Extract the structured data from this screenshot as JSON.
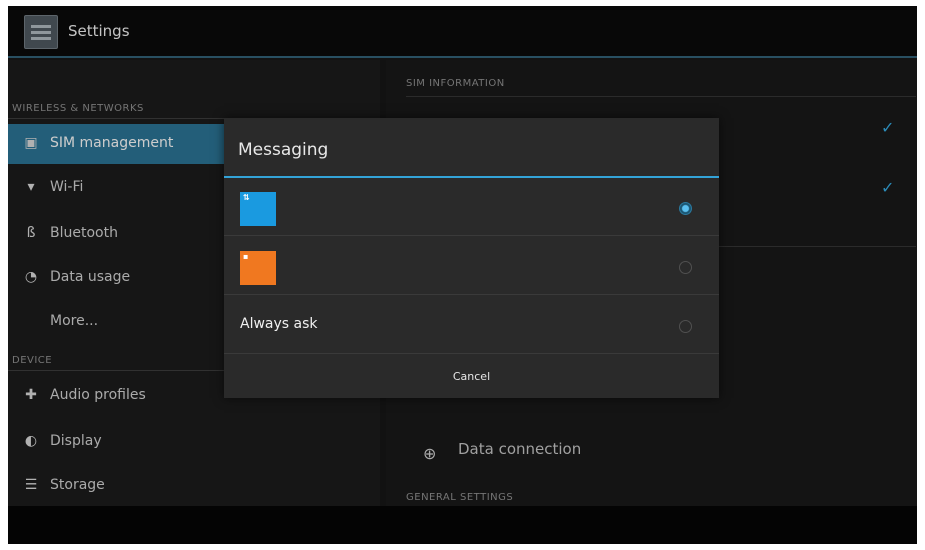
{
  "action_bar": {
    "title": "Settings",
    "icon": "settings-icon"
  },
  "left_pane": {
    "sections": [
      {
        "header": "WIRELESS & NETWORKS",
        "items": [
          {
            "label": "SIM management",
            "icon": "sim-icon",
            "selected": true
          },
          {
            "label": "Wi-Fi",
            "icon": "wifi-icon"
          },
          {
            "label": "Bluetooth",
            "icon": "bluetooth-icon"
          },
          {
            "label": "Data usage",
            "icon": "data-usage-icon"
          },
          {
            "label": "More...",
            "icon": ""
          }
        ]
      },
      {
        "header": "DEVICE",
        "items": [
          {
            "label": "Audio profiles",
            "icon": "audio-profiles-icon"
          },
          {
            "label": "Display",
            "icon": "display-icon"
          },
          {
            "label": "Storage",
            "icon": "storage-icon"
          }
        ]
      }
    ]
  },
  "right_pane": {
    "sim_information_header": "SIM INFORMATION",
    "data_connection_label": "Data connection",
    "general_settings_header": "GENERAL SETTINGS"
  },
  "dialog": {
    "title": "Messaging",
    "options": [
      {
        "type": "sim",
        "tile_color": "#1a9ae0",
        "tile_mark": "⇅",
        "selected": true
      },
      {
        "type": "sim",
        "tile_color": "#f07820",
        "tile_mark": "▪",
        "selected": false
      },
      {
        "type": "text",
        "label": "Always ask",
        "selected": false
      }
    ],
    "cancel_label": "Cancel"
  },
  "colors": {
    "accent": "#33a3d8",
    "selected_row": "#2a6f8f"
  }
}
